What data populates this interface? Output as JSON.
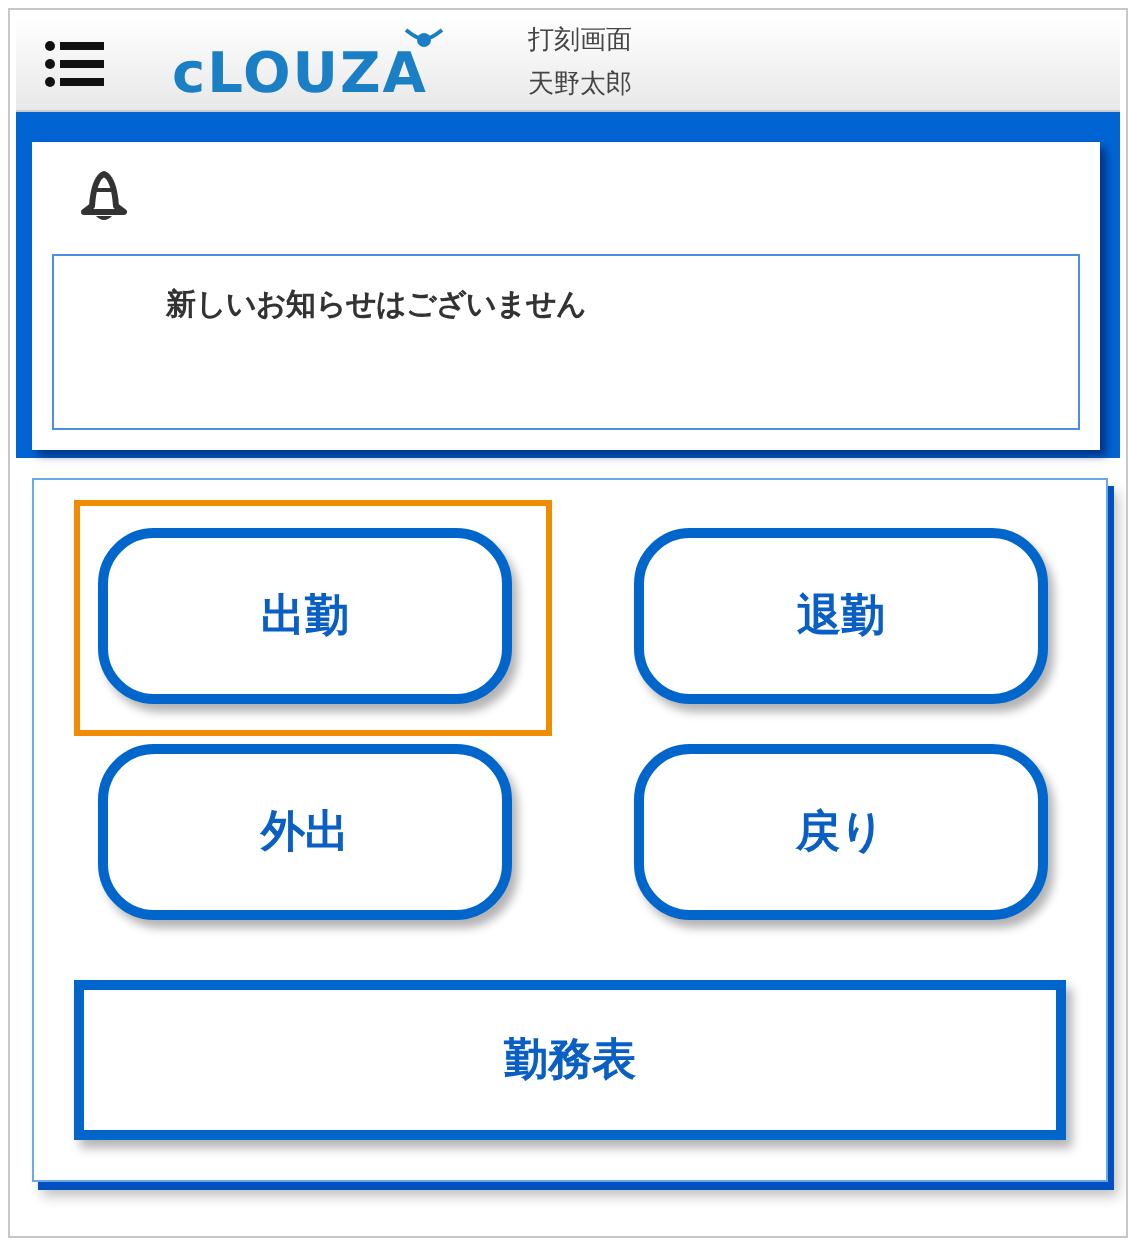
{
  "header": {
    "logo": "cLOUZA",
    "screen_title": "打刻画面",
    "user_name": "天野太郎"
  },
  "notice": {
    "message": "新しいお知らせはございません"
  },
  "punch_buttons": [
    {
      "label": "出勤",
      "highlighted": true
    },
    {
      "label": "退勤",
      "highlighted": false
    },
    {
      "label": "外出",
      "highlighted": false
    },
    {
      "label": "戻り",
      "highlighted": false
    }
  ],
  "timesheet_button": {
    "label": "勤務表"
  }
}
